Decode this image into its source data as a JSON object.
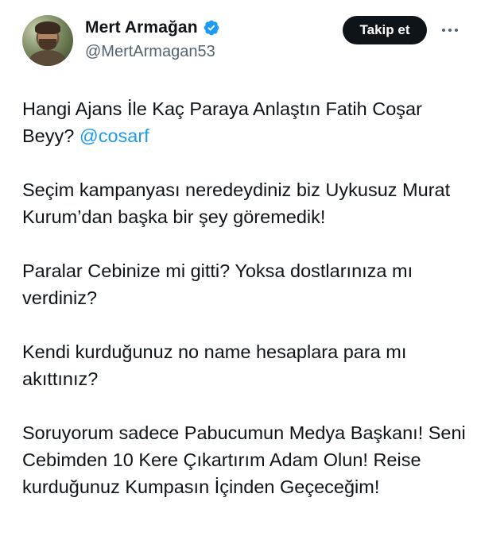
{
  "author": {
    "display_name": "Mert Armağan",
    "handle": "@MertArmagan53",
    "verified": true,
    "verified_color": "#1d9bf0"
  },
  "actions": {
    "follow_label": "Takip et",
    "more_icon": "more-horizontal-icon"
  },
  "tweet": {
    "p1_text": "Hangi Ajans İle Kaç Paraya Anlaştın Fatih Coşar Beyy?",
    "p1_mention": "@cosarf",
    "p2": "Seçim kampanyası neredeydiniz biz Uykusuz Murat Kurum’dan başka bir şey göremedik!",
    "p3": "Paralar Cebinize mi gitti? Yoksa dostlarınıza mı verdiniz?",
    "p4": "Kendi kurduğunuz no name hesaplara para mı akıttınız?",
    "p5": "Soruyorum sadece Pabucumun Medya Başkanı! Seni Cebimden 10 Kere Çıkartırım Adam Olun! Reise kurduğunuz Kumpasın İçinden Geçeceğim!"
  }
}
